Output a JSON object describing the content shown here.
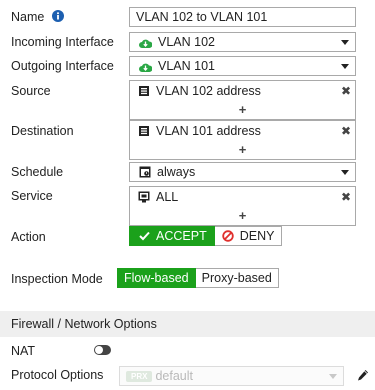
{
  "form": {
    "name_label": "Name",
    "name_value": "VLAN 102 to VLAN 101",
    "incoming_label": "Incoming Interface",
    "incoming_value": "VLAN 102",
    "outgoing_label": "Outgoing Interface",
    "outgoing_value": "VLAN 101",
    "source_label": "Source",
    "source_value": "VLAN 102 address",
    "destination_label": "Destination",
    "destination_value": "VLAN 101 address",
    "schedule_label": "Schedule",
    "schedule_value": "always",
    "service_label": "Service",
    "service_value": "ALL",
    "add_symbol": "+",
    "remove_symbol": "✖",
    "action_label": "Action",
    "action_accept": "ACCEPT",
    "action_deny": "DENY",
    "inspection_label": "Inspection Mode",
    "inspection_flow": "Flow-based",
    "inspection_proxy": "Proxy-based"
  },
  "firewall": {
    "section_title": "Firewall / Network Options",
    "nat_label": "NAT",
    "nat_enabled": false,
    "protocol_label": "Protocol Options",
    "protocol_badge": "PRX",
    "protocol_value": "default"
  },
  "colors": {
    "accent_green": "#1ba11b",
    "interface_icon": "#2aa745",
    "deny_red": "#e0302d",
    "info_blue": "#1c5fb0"
  },
  "selected": {
    "action": "ACCEPT",
    "inspection_mode": "Flow-based"
  }
}
